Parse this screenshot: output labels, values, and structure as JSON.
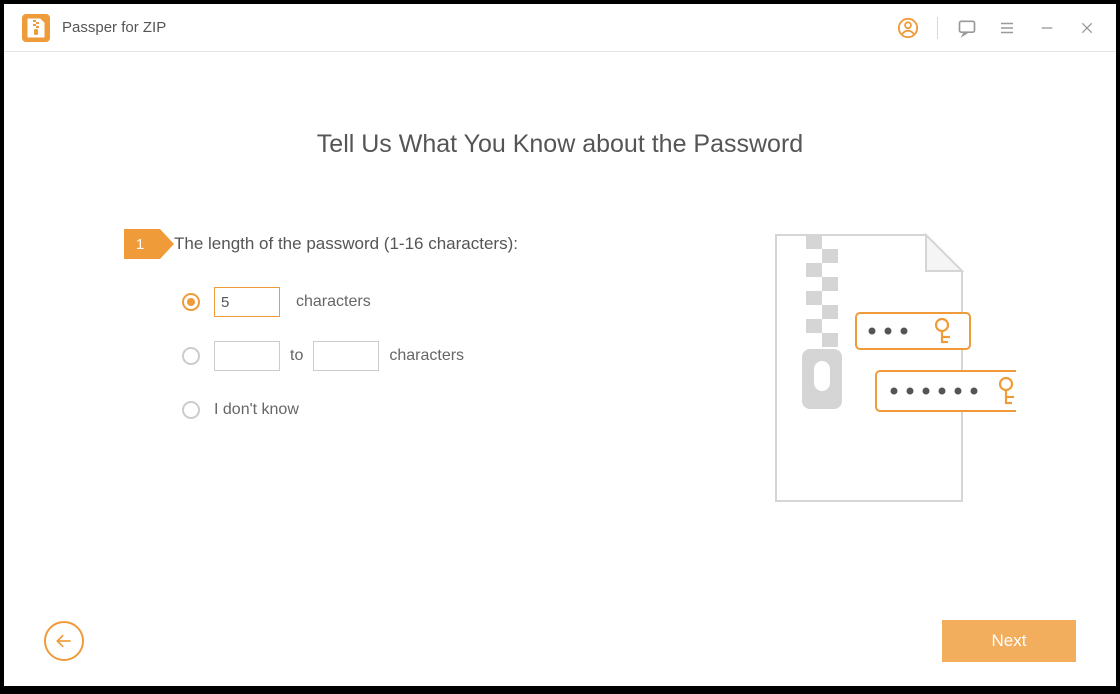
{
  "app": {
    "title": "Passper for ZIP"
  },
  "page": {
    "heading": "Tell Us What You Know about the Password",
    "step": {
      "number": "1",
      "label": "The length of the password (1-16 characters):"
    },
    "options": {
      "exact": {
        "value": "5",
        "unit": "characters",
        "selected": true
      },
      "range": {
        "from": "",
        "to": "",
        "connector": "to",
        "unit": "characters",
        "selected": false
      },
      "unknown": {
        "label": "I don't know",
        "selected": false
      }
    }
  },
  "footer": {
    "next": "Next"
  }
}
